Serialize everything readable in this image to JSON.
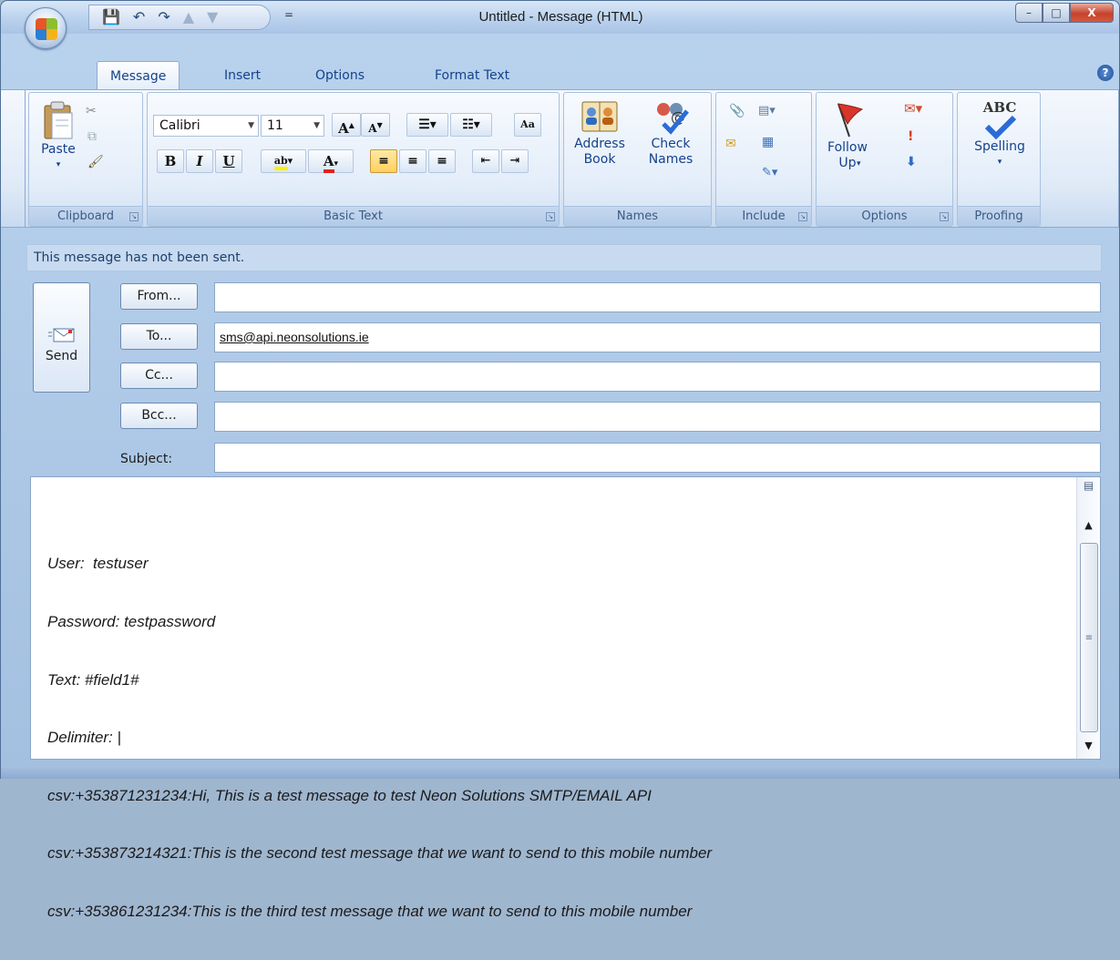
{
  "window": {
    "title": "Untitled - Message (HTML)"
  },
  "window_controls": {
    "minimize": "–",
    "maximize": "□",
    "close": "X"
  },
  "qat": {
    "save": "💾",
    "undo": "↶",
    "redo": "↷",
    "prev": "▲",
    "next": "▼",
    "dropdown": "="
  },
  "tabs": [
    "Message",
    "Insert",
    "Options",
    "Format Text"
  ],
  "ribbon": {
    "clipboard": {
      "paste": "Paste",
      "group": "Clipboard"
    },
    "basic_text": {
      "font": "Calibri",
      "size": "11",
      "bold": "B",
      "italic": "I",
      "underline": "U",
      "grow": "A",
      "shrink": "A",
      "group": "Basic Text"
    },
    "names": {
      "address_book": "Address Book",
      "check_names": "Check Names",
      "group": "Names"
    },
    "include": {
      "group": "Include"
    },
    "options": {
      "follow_up": "Follow Up",
      "group": "Options"
    },
    "proofing": {
      "spelling": "Spelling",
      "spelling_icon": "ABC",
      "group": "Proofing"
    }
  },
  "infobar": "This message has not been sent.",
  "header": {
    "send": "Send",
    "from": "From...",
    "to": "To...",
    "cc": "Cc...",
    "bcc": "Bcc...",
    "subject_label": "Subject:",
    "to_value": "sms@api.neonsolutions.ie",
    "from_value": "",
    "cc_value": "",
    "bcc_value": "",
    "subject_value": ""
  },
  "body_lines": [
    "User:  testuser",
    "Password: testpassword",
    "Text: #field1#",
    "Delimiter: |",
    "csv:+353871231234:Hi, This is a test message to test Neon Solutions SMTP/EMAIL API",
    "csv:+353873214321:This is the second test message that we want to send to this mobile number",
    "csv:+353861231234:This is the third test message that we want to send to this mobile number"
  ]
}
